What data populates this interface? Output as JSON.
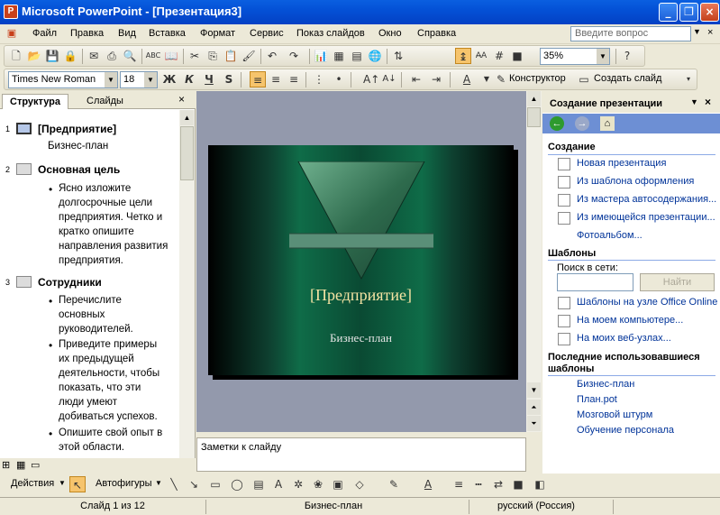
{
  "window": {
    "title": "Microsoft PowerPoint - [Презентация3]",
    "app_icon": "P"
  },
  "menu": [
    "Файл",
    "Правка",
    "Вид",
    "Вставка",
    "Формат",
    "Сервис",
    "Показ слайдов",
    "Окно",
    "Справка"
  ],
  "help_box": {
    "placeholder": "Введите вопрос"
  },
  "toolbar": {
    "zoom": "35%",
    "font": "Times New Roman",
    "font_size": "18",
    "bold": "Ж",
    "italic": "К",
    "underline": "Ч",
    "shadow": "S",
    "designer": "Конструктор",
    "new_slide": "Создать слайд"
  },
  "left_pane": {
    "tabs": [
      "Структура",
      "Слайды"
    ],
    "slides": [
      {
        "num": "1",
        "title": "[Предприятие]",
        "lines": [
          "Бизнес-план"
        ]
      },
      {
        "num": "2",
        "title": "Основная цель",
        "bullets": [
          [
            "Ясно изложите",
            "долгосрочные цели",
            "предприятия. Четко и",
            "кратко опишите",
            "направления развития",
            "предприятия."
          ]
        ]
      },
      {
        "num": "3",
        "title": "Сотрудники",
        "bullets": [
          [
            "Перечислите",
            "основных",
            "руководителей."
          ],
          [
            "Приведите примеры",
            "их предыдущей",
            "деятельности, чтобы",
            "показать, что эти",
            "люди умеют",
            "добиваться успехов."
          ],
          [
            "Опишите свой опыт в",
            "этой области."
          ]
        ]
      }
    ]
  },
  "slide": {
    "title": "[Предприятие]",
    "subtitle": "Бизнес-план"
  },
  "notes": "Заметки к слайду",
  "task_pane": {
    "title": "Создание презентации",
    "section_create": "Создание",
    "create_links": [
      "Новая презентация",
      "Из шаблона оформления",
      "Из мастера автосодержания...",
      "Из имеющейся презентации...",
      "Фотоальбом..."
    ],
    "section_templates": "Шаблоны",
    "search_label": "Поиск в сети:",
    "search_button": "Найти",
    "template_links": [
      "Шаблоны на узле Office Online",
      "На моем компьютере...",
      "На моих веб-узлах..."
    ],
    "section_recent": "Последние использовавшиеся шаблоны",
    "recent_links": [
      "Бизнес-план",
      "План.pot",
      "Мозговой штурм",
      "Обучение персонала"
    ]
  },
  "draw_toolbar": {
    "actions": "Действия",
    "autoshapes": "Автофигуры"
  },
  "status": {
    "slide": "Слайд 1 из 12",
    "design": "Бизнес-план",
    "language": "русский (Россия)"
  },
  "colors": {
    "accent": "#0451d6",
    "link": "#003399",
    "slide_green": "#0f6c48"
  }
}
